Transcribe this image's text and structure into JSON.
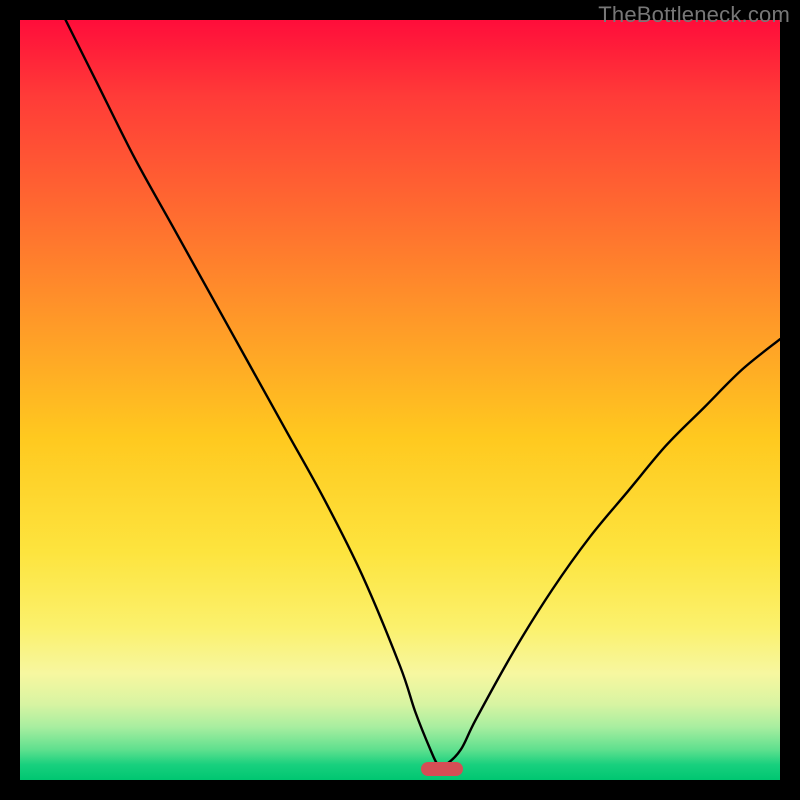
{
  "watermark": "TheBottleneck.com",
  "colors": {
    "frame_bg": "#000000",
    "curve_stroke": "#000000",
    "marker_fill": "#d54e55",
    "gradient": [
      "#ff0d3a",
      "#ff3b38",
      "#ff6a30",
      "#ff9a28",
      "#ffc91f",
      "#fde43e",
      "#fbf16d",
      "#f7f7a0",
      "#d8f4a2",
      "#a8eea0",
      "#5fe08e",
      "#18d07e",
      "#00c671"
    ]
  },
  "chart_data": {
    "type": "line",
    "title": "",
    "xlabel": "",
    "ylabel": "",
    "xlim": [
      0,
      100
    ],
    "ylim": [
      0,
      100
    ],
    "grid": false,
    "legend": false,
    "series": [
      {
        "name": "bottleneck-curve",
        "x": [
          6,
          10,
          15,
          20,
          25,
          30,
          35,
          40,
          45,
          50,
          52,
          54,
          55,
          56,
          58,
          60,
          65,
          70,
          75,
          80,
          85,
          90,
          95,
          100
        ],
        "y": [
          100,
          92,
          82,
          73,
          64,
          55,
          46,
          37,
          27,
          15,
          9,
          4,
          2,
          2,
          4,
          8,
          17,
          25,
          32,
          38,
          44,
          49,
          54,
          58
        ]
      }
    ],
    "marker": {
      "x": 55.5,
      "y": 1.5
    },
    "annotation_text": "TheBottleneck.com"
  }
}
